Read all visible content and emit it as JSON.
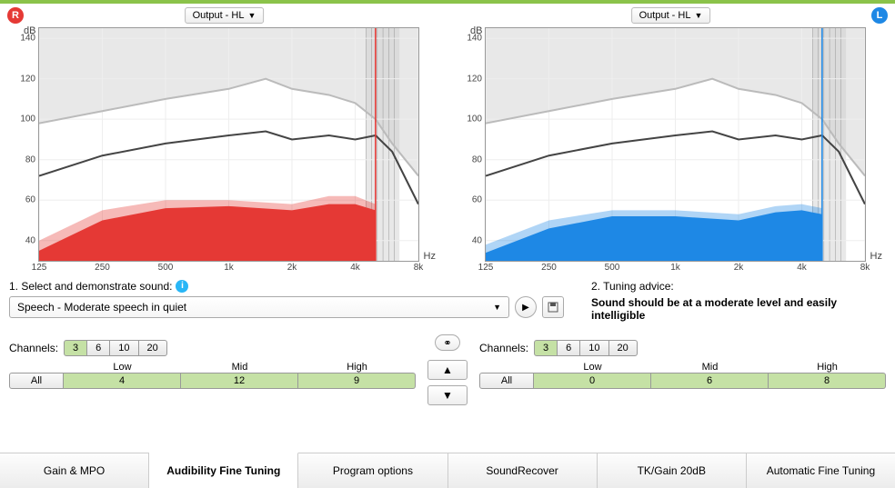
{
  "chart_data": [
    {
      "type": "area",
      "side": "R",
      "xlabel": "Hz",
      "ylabel": "dB",
      "xscale": "log",
      "xlim": [
        125,
        8000
      ],
      "ylim": [
        30,
        145
      ],
      "xticks": [
        125,
        250,
        500,
        1000,
        2000,
        4000,
        8000
      ],
      "xticklabels": [
        "125",
        "250",
        "500",
        "1k",
        "2k",
        "4k",
        "8k"
      ],
      "yticks": [
        40,
        60,
        80,
        100,
        120,
        140
      ],
      "series": [
        {
          "name": "upper-bound",
          "x": [
            125,
            250,
            500,
            1000,
            1500,
            2000,
            3000,
            4000,
            5000,
            6000,
            8000
          ],
          "values": [
            98,
            104,
            110,
            115,
            120,
            115,
            112,
            108,
            100,
            88,
            72
          ],
          "style": "light-gray-line"
        },
        {
          "name": "target",
          "x": [
            125,
            250,
            500,
            1000,
            1500,
            2000,
            3000,
            4000,
            5000,
            6000,
            8000
          ],
          "values": [
            72,
            82,
            88,
            92,
            94,
            90,
            92,
            90,
            92,
            84,
            58
          ],
          "style": "dark-line"
        },
        {
          "name": "speech-band-upper",
          "x": [
            125,
            250,
            500,
            1000,
            2000,
            3000,
            4000,
            5000
          ],
          "values": [
            40,
            55,
            60,
            60,
            58,
            62,
            62,
            58
          ],
          "style": "red-light-area"
        },
        {
          "name": "speech-band",
          "x": [
            125,
            250,
            500,
            1000,
            2000,
            3000,
            4000,
            5000
          ],
          "values": [
            35,
            50,
            56,
            57,
            55,
            58,
            58,
            55
          ],
          "style": "red-area"
        }
      ],
      "marker_x": 5000,
      "shaded_region": [
        4500,
        6500
      ]
    },
    {
      "type": "area",
      "side": "L",
      "xlabel": "Hz",
      "ylabel": "dB",
      "xscale": "log",
      "xlim": [
        125,
        8000
      ],
      "ylim": [
        30,
        145
      ],
      "xticks": [
        125,
        250,
        500,
        1000,
        2000,
        4000,
        8000
      ],
      "xticklabels": [
        "125",
        "250",
        "500",
        "1k",
        "2k",
        "4k",
        "8k"
      ],
      "yticks": [
        40,
        60,
        80,
        100,
        120,
        140
      ],
      "series": [
        {
          "name": "upper-bound",
          "x": [
            125,
            250,
            500,
            1000,
            1500,
            2000,
            3000,
            4000,
            5000,
            6000,
            8000
          ],
          "values": [
            98,
            104,
            110,
            115,
            120,
            115,
            112,
            108,
            100,
            88,
            72
          ],
          "style": "light-gray-line"
        },
        {
          "name": "target",
          "x": [
            125,
            250,
            500,
            1000,
            1500,
            2000,
            3000,
            4000,
            5000,
            6000,
            8000
          ],
          "values": [
            72,
            82,
            88,
            92,
            94,
            90,
            92,
            90,
            92,
            84,
            58
          ],
          "style": "dark-line"
        },
        {
          "name": "speech-band-upper",
          "x": [
            125,
            250,
            500,
            1000,
            2000,
            3000,
            4000,
            5000
          ],
          "values": [
            38,
            50,
            55,
            55,
            53,
            57,
            58,
            56
          ],
          "style": "blue-light-area"
        },
        {
          "name": "speech-band",
          "x": [
            125,
            250,
            500,
            1000,
            2000,
            3000,
            4000,
            5000
          ],
          "values": [
            34,
            46,
            52,
            52,
            50,
            54,
            55,
            53
          ],
          "style": "blue-area"
        }
      ],
      "marker_x": 5000,
      "shaded_region": [
        4500,
        6500
      ]
    }
  ],
  "output_dropdown": "Output - HL",
  "badges": {
    "r": "R",
    "l": "L"
  },
  "section1": {
    "label": "1. Select and demonstrate sound:",
    "selected": "Speech - Moderate speech in quiet"
  },
  "section2": {
    "label": "2. Tuning advice:",
    "advice": "Sound should be at a moderate level and easily intelligible"
  },
  "channels": {
    "label": "Channels:",
    "options": [
      "3",
      "6",
      "10",
      "20"
    ],
    "active": "3",
    "freq_labels": [
      "Low",
      "Mid",
      "High"
    ],
    "all_label": "All",
    "left_values": [
      "4",
      "12",
      "9"
    ],
    "right_values": [
      "0",
      "6",
      "8"
    ]
  },
  "tabs": [
    "Gain & MPO",
    "Audibility Fine Tuning",
    "Program options",
    "SoundRecover",
    "TK/Gain 20dB",
    "Automatic Fine Tuning"
  ],
  "active_tab": "Audibility Fine Tuning"
}
